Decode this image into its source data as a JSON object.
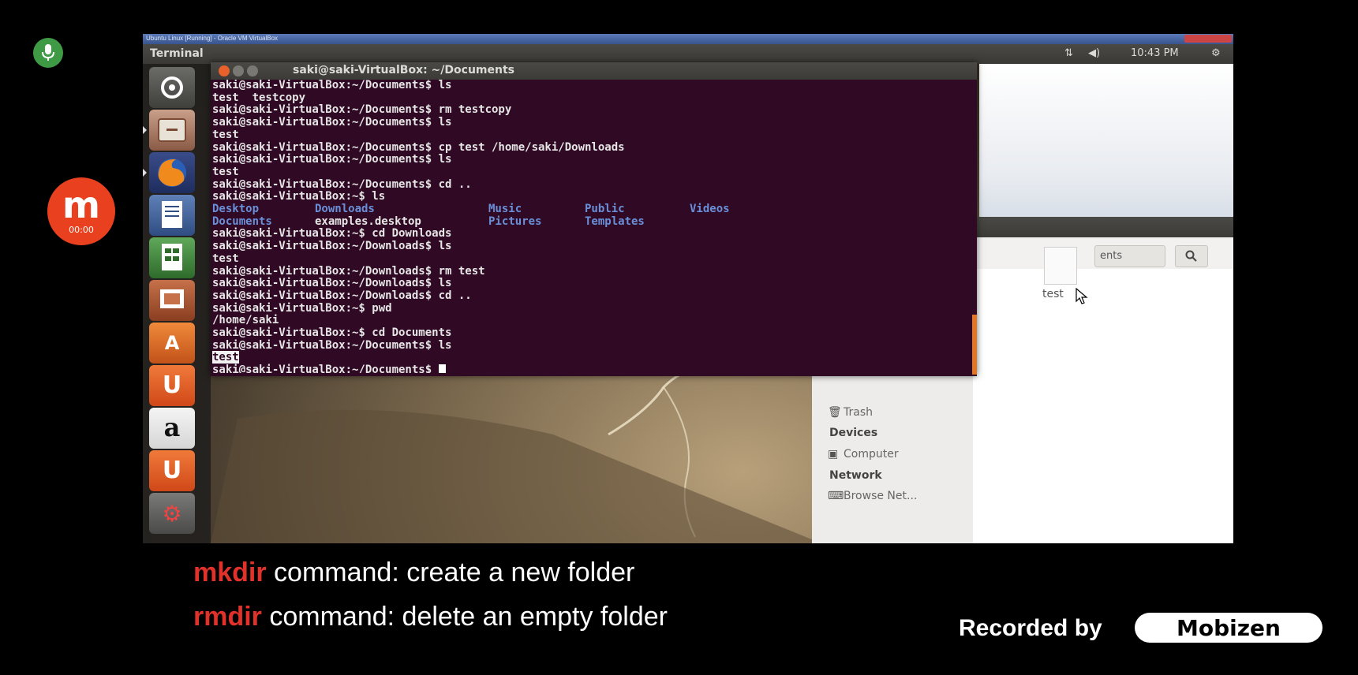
{
  "overlay": {
    "recorder_timer": "00:00",
    "recorder_logo": "m",
    "recorded_by": "Recorded by",
    "brand": "Mobizen"
  },
  "vbox": {
    "window_title": "Ubuntu Linux [Running] - Oracle VM VirtualBox"
  },
  "panel": {
    "app_title": "Terminal",
    "time": "10:43 PM",
    "icons": [
      "network-icon",
      "volume-icon",
      "gear-icon"
    ]
  },
  "launcher": {
    "items": [
      "ubuntu-dash-icon",
      "file-manager-icon",
      "firefox-icon",
      "writer-icon",
      "calc-icon",
      "impress-icon",
      "software-center-icon",
      "ubuntu-one-icon",
      "amazon-icon",
      "ubuntu-one-music-icon",
      "system-settings-icon"
    ]
  },
  "terminal": {
    "title": "saki@saki-VirtualBox: ~/Documents",
    "lines": [
      "saki@saki-VirtualBox:~/Documents$ ls",
      "test  testcopy",
      "saki@saki-VirtualBox:~/Documents$ rm testcopy",
      "saki@saki-VirtualBox:~/Documents$ ls",
      "test",
      "saki@saki-VirtualBox:~/Documents$ cp test /home/saki/Downloads",
      "saki@saki-VirtualBox:~/Documents$ ls",
      "test",
      "saki@saki-VirtualBox:~/Documents$ cd ..",
      "saki@saki-VirtualBox:~$ ls"
    ],
    "ls_home": [
      "Desktop",
      "Downloads",
      "Music",
      "Public",
      "Videos",
      "Documents",
      "examples.desktop",
      "Pictures",
      "Templates"
    ],
    "lines2": [
      "saki@saki-VirtualBox:~$ cd Downloads",
      "saki@saki-VirtualBox:~/Downloads$ ls",
      "test",
      "saki@saki-VirtualBox:~/Downloads$ rm test",
      "saki@saki-VirtualBox:~/Downloads$ ls",
      "saki@saki-VirtualBox:~/Downloads$ cd ..",
      "saki@saki-VirtualBox:~$ pwd",
      "/home/saki",
      "saki@saki-VirtualBox:~$ cd Documents",
      "saki@saki-VirtualBox:~/Documents$ ls"
    ],
    "selected_output": "test",
    "prompt": "saki@saki-VirtualBox:~/Documents$ "
  },
  "file_manager": {
    "breadcrumb": "ents",
    "file_name": "test",
    "sidebar": {
      "trash": "Trash",
      "devices_heading": "Devices",
      "computer": "Computer",
      "network_heading": "Network",
      "browse_network": "Browse Net..."
    }
  },
  "captions": [
    {
      "cmd": "mkdir",
      "text": " command: create a new folder"
    },
    {
      "cmd": "rmdir",
      "text": " command: delete an empty folder"
    }
  ],
  "colors": {
    "terminal_bg": "#300a24",
    "caption_cmd": "#e0312b",
    "dir_blue": "#6a8fd9",
    "recorder": "#e9411f"
  }
}
